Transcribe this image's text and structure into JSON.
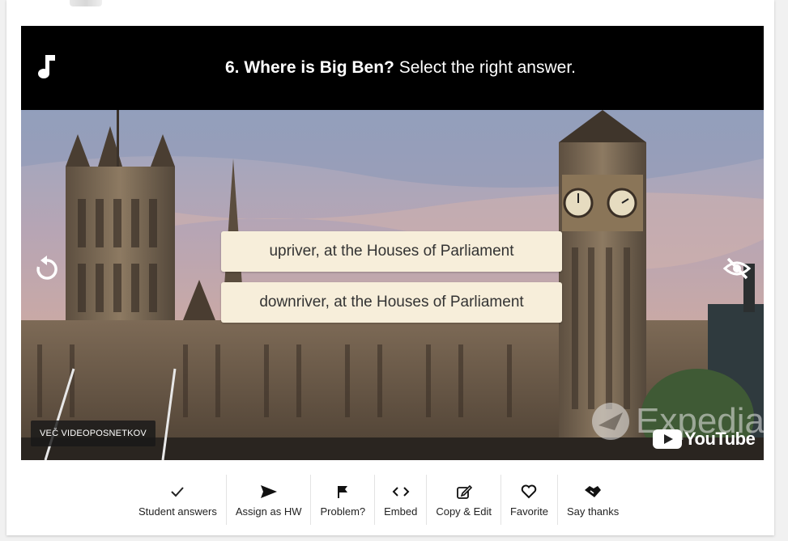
{
  "question": {
    "number_title": "6. Where is Big Ben?",
    "instruction": "Select the right answer."
  },
  "answers": [
    "upriver, at the Houses of Parliament",
    "downriver, at the Houses of Parliament"
  ],
  "overlay": {
    "more_videos": "VEČ VIDEOPOSNETKOV",
    "watermark": "Expedia",
    "youtube": "YouTube"
  },
  "toolbar": [
    {
      "label": "Student answers",
      "icon": "check-icon"
    },
    {
      "label": "Assign as HW",
      "icon": "send-icon"
    },
    {
      "label": "Problem?",
      "icon": "flag-icon"
    },
    {
      "label": "Embed",
      "icon": "code-icon"
    },
    {
      "label": "Copy & Edit",
      "icon": "edit-icon"
    },
    {
      "label": "Favorite",
      "icon": "heart-icon"
    },
    {
      "label": "Say thanks",
      "icon": "handshake-icon"
    }
  ],
  "colors": {
    "answer_bg": "#f7eeda",
    "question_bar": "#000000"
  }
}
